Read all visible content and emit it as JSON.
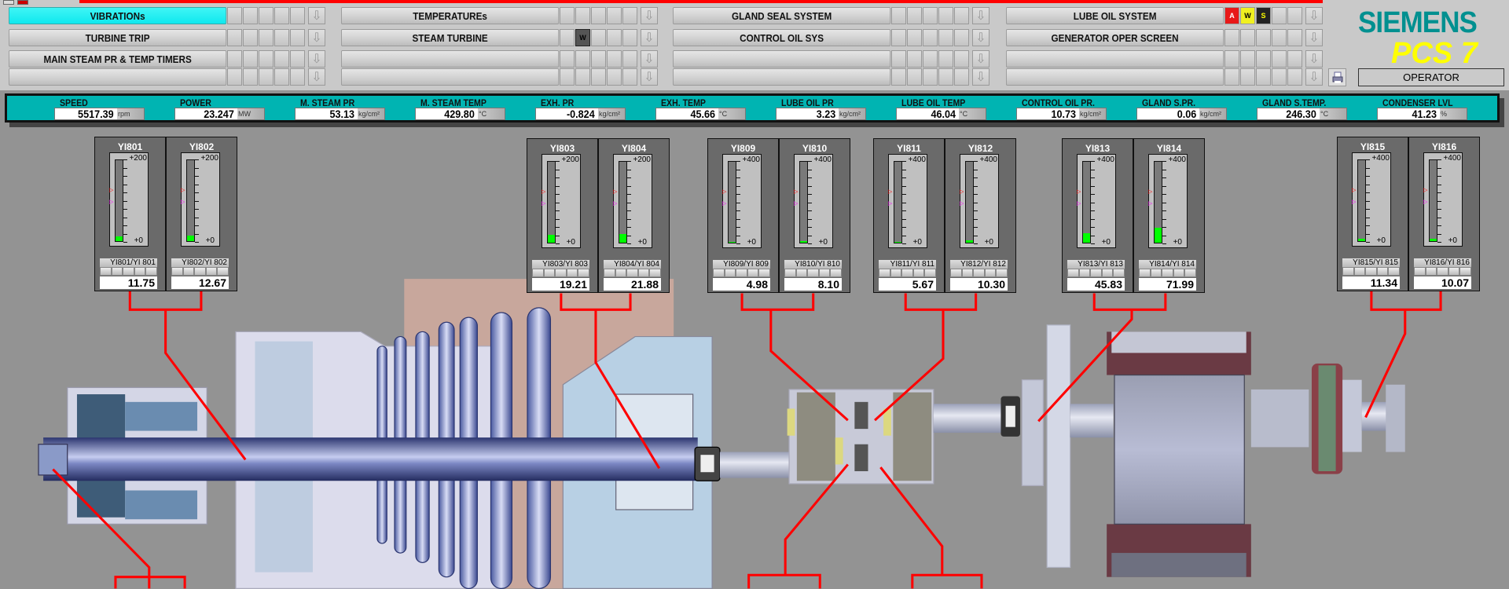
{
  "nav": {
    "columns": [
      {
        "rows": [
          {
            "label": "VIBRATIONs",
            "active": true,
            "badges": []
          },
          {
            "label": "TURBINE TRIP",
            "badges": []
          },
          {
            "label": "MAIN STEAM PR & TEMP TIMERS",
            "badges": []
          },
          {
            "label": "",
            "badges": []
          }
        ]
      },
      {
        "rows": [
          {
            "label": "TEMPERATUREs",
            "badges": []
          },
          {
            "label": "STEAM TURBINE",
            "badges": [
              {
                "slot": 1,
                "text": "W",
                "type": "dk"
              }
            ]
          },
          {
            "label": "",
            "badges": []
          },
          {
            "label": "",
            "badges": []
          }
        ]
      },
      {
        "rows": [
          {
            "label": "GLAND SEAL SYSTEM",
            "badges": []
          },
          {
            "label": "CONTROL OIL SYS",
            "badges": []
          },
          {
            "label": "",
            "badges": []
          },
          {
            "label": "",
            "badges": []
          }
        ]
      },
      {
        "rows": [
          {
            "label": "LUBE OIL SYSTEM",
            "badges": [
              {
                "slot": 0,
                "text": "A",
                "type": "a"
              },
              {
                "slot": 1,
                "text": "W",
                "type": "w"
              },
              {
                "slot": 2,
                "text": "S",
                "type": "s"
              }
            ]
          },
          {
            "label": "GENERATOR OPER SCREEN",
            "badges": []
          },
          {
            "label": "",
            "badges": []
          },
          {
            "label": "",
            "badges": []
          }
        ]
      }
    ],
    "arrow_icon": "arrow-down-icon"
  },
  "logo": {
    "brand": "SIEMENS",
    "product": "PCS 7"
  },
  "user": {
    "role": "OPERATOR"
  },
  "measurements": [
    {
      "label": "SPEED",
      "value": "5517.39",
      "unit": "rpm"
    },
    {
      "label": "POWER",
      "value": "23.247",
      "unit": "MW"
    },
    {
      "label": "M. STEAM PR",
      "value": "53.13",
      "unit": "kg/cm²"
    },
    {
      "label": "M. STEAM TEMP",
      "value": "429.80",
      "unit": "°C"
    },
    {
      "label": "EXH. PR",
      "value": "-0.824",
      "unit": "kg/cm²"
    },
    {
      "label": "EXH. TEMP",
      "value": "45.66",
      "unit": "°C"
    },
    {
      "label": "LUBE OIL PR",
      "value": "3.23",
      "unit": "kg/cm²"
    },
    {
      "label": "LUBE OIL TEMP",
      "value": "46.04",
      "unit": "°C"
    },
    {
      "label": "CONTROL OIL PR.",
      "value": "10.73",
      "unit": "kg/cm²"
    },
    {
      "label": "GLAND S.PR.",
      "value": "0.06",
      "unit": "kg/cm²"
    },
    {
      "label": "GLAND S.TEMP.",
      "value": "246.30",
      "unit": "°C"
    },
    {
      "label": "CONDENSER LVL",
      "value": "41.23",
      "unit": "%"
    }
  ],
  "gauges": [
    {
      "title": "YI801",
      "tag": "YI801/YI  801",
      "value": "11.75",
      "max": "+200",
      "min": "+0",
      "scale": 200
    },
    {
      "title": "YI802",
      "tag": "YI802/YI  802",
      "value": "12.67",
      "max": "+200",
      "min": "+0",
      "scale": 200
    },
    {
      "title": "YI803",
      "tag": "YI803/YI  803",
      "value": "19.21",
      "max": "+200",
      "min": "+0",
      "scale": 200
    },
    {
      "title": "YI804",
      "tag": "YI804/YI  804",
      "value": "21.88",
      "max": "+200",
      "min": "+0",
      "scale": 200
    },
    {
      "title": "YI809",
      "tag": "YI809/YI  809",
      "value": "4.98",
      "max": "+400",
      "min": "+0",
      "scale": 400
    },
    {
      "title": "YI810",
      "tag": "YI810/YI  810",
      "value": "8.10",
      "max": "+400",
      "min": "+0",
      "scale": 400
    },
    {
      "title": "YI811",
      "tag": "YI811/YI  811",
      "value": "5.67",
      "max": "+400",
      "min": "+0",
      "scale": 400
    },
    {
      "title": "YI812",
      "tag": "YI812/YI  812",
      "value": "10.30",
      "max": "+400",
      "min": "+0",
      "scale": 400
    },
    {
      "title": "YI813",
      "tag": "YI813/YI  813",
      "value": "45.83",
      "max": "+400",
      "min": "+0",
      "scale": 400
    },
    {
      "title": "YI814",
      "tag": "YI814/YI  814",
      "value": "71.99",
      "max": "+400",
      "min": "+0",
      "scale": 400
    },
    {
      "title": "YI815",
      "tag": "YI815/YI  815",
      "value": "11.34",
      "max": "+400",
      "min": "+0",
      "scale": 400
    },
    {
      "title": "YI816",
      "tag": "YI816/YI  816",
      "value": "10.07",
      "max": "+400",
      "min": "+0",
      "scale": 400
    }
  ],
  "colors": {
    "accent": "#00b4b2",
    "active_button": "#1ff0f2",
    "alarm_line": "#ff0000",
    "bar_fill": "#00ff00",
    "background": "#939393"
  }
}
